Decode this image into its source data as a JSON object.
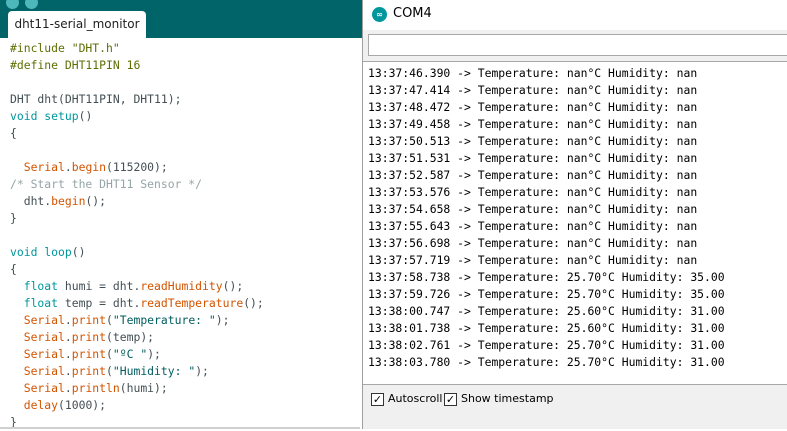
{
  "ide": {
    "tab_label": "dht11-serial_monitor",
    "code": [
      [
        {
          "t": "#include \"DHT.h\"",
          "c": "kw-pre"
        }
      ],
      [
        {
          "t": "#define DHT11PIN 16",
          "c": "kw-pre"
        }
      ],
      [],
      [
        {
          "t": "DHT dht(DHT11PIN, DHT11);",
          "c": ""
        }
      ],
      [
        {
          "t": "void",
          "c": "kw-type"
        },
        {
          "t": " ",
          "c": ""
        },
        {
          "t": "setup",
          "c": "kw-type"
        },
        {
          "t": "()",
          "c": ""
        }
      ],
      [
        {
          "t": "{",
          "c": ""
        }
      ],
      [],
      [
        {
          "t": "  ",
          "c": ""
        },
        {
          "t": "Serial",
          "c": "kw-fn"
        },
        {
          "t": ".",
          "c": ""
        },
        {
          "t": "begin",
          "c": "kw-fn"
        },
        {
          "t": "(115200);",
          "c": ""
        }
      ],
      [
        {
          "t": "/* Start the DHT11 Sensor */",
          "c": "cmt"
        }
      ],
      [
        {
          "t": "  dht.",
          "c": ""
        },
        {
          "t": "begin",
          "c": "kw-fn"
        },
        {
          "t": "();",
          "c": ""
        }
      ],
      [
        {
          "t": "}",
          "c": ""
        }
      ],
      [],
      [
        {
          "t": "void",
          "c": "kw-type"
        },
        {
          "t": " ",
          "c": ""
        },
        {
          "t": "loop",
          "c": "kw-type"
        },
        {
          "t": "()",
          "c": ""
        }
      ],
      [
        {
          "t": "{",
          "c": ""
        }
      ],
      [
        {
          "t": "  ",
          "c": ""
        },
        {
          "t": "float",
          "c": "kw-type"
        },
        {
          "t": " humi = dht.",
          "c": ""
        },
        {
          "t": "readHumidity",
          "c": "kw-fn"
        },
        {
          "t": "();",
          "c": ""
        }
      ],
      [
        {
          "t": "  ",
          "c": ""
        },
        {
          "t": "float",
          "c": "kw-type"
        },
        {
          "t": " temp = dht.",
          "c": ""
        },
        {
          "t": "readTemperature",
          "c": "kw-fn"
        },
        {
          "t": "();",
          "c": ""
        }
      ],
      [
        {
          "t": "  ",
          "c": ""
        },
        {
          "t": "Serial",
          "c": "kw-fn"
        },
        {
          "t": ".",
          "c": ""
        },
        {
          "t": "print",
          "c": "kw-fn"
        },
        {
          "t": "(",
          "c": ""
        },
        {
          "t": "\"Temperature: \"",
          "c": "str"
        },
        {
          "t": ");",
          "c": ""
        }
      ],
      [
        {
          "t": "  ",
          "c": ""
        },
        {
          "t": "Serial",
          "c": "kw-fn"
        },
        {
          "t": ".",
          "c": ""
        },
        {
          "t": "print",
          "c": "kw-fn"
        },
        {
          "t": "(temp);",
          "c": ""
        }
      ],
      [
        {
          "t": "  ",
          "c": ""
        },
        {
          "t": "Serial",
          "c": "kw-fn"
        },
        {
          "t": ".",
          "c": ""
        },
        {
          "t": "print",
          "c": "kw-fn"
        },
        {
          "t": "(",
          "c": ""
        },
        {
          "t": "\"ºC \"",
          "c": "str"
        },
        {
          "t": ");",
          "c": ""
        }
      ],
      [
        {
          "t": "  ",
          "c": ""
        },
        {
          "t": "Serial",
          "c": "kw-fn"
        },
        {
          "t": ".",
          "c": ""
        },
        {
          "t": "print",
          "c": "kw-fn"
        },
        {
          "t": "(",
          "c": ""
        },
        {
          "t": "\"Humidity: \"",
          "c": "str"
        },
        {
          "t": ");",
          "c": ""
        }
      ],
      [
        {
          "t": "  ",
          "c": ""
        },
        {
          "t": "Serial",
          "c": "kw-fn"
        },
        {
          "t": ".",
          "c": ""
        },
        {
          "t": "println",
          "c": "kw-fn"
        },
        {
          "t": "(humi);",
          "c": ""
        }
      ],
      [
        {
          "t": "  ",
          "c": ""
        },
        {
          "t": "delay",
          "c": "kw-fn"
        },
        {
          "t": "(1000);",
          "c": ""
        }
      ],
      [
        {
          "t": "}",
          "c": ""
        }
      ]
    ]
  },
  "serial": {
    "window_title": "COM4",
    "send_input_value": "",
    "lines": [
      "13:37:46.390 -> Temperature: nan°C Humidity: nan",
      "13:37:47.414 -> Temperature: nan°C Humidity: nan",
      "13:37:48.472 -> Temperature: nan°C Humidity: nan",
      "13:37:49.458 -> Temperature: nan°C Humidity: nan",
      "13:37:50.513 -> Temperature: nan°C Humidity: nan",
      "13:37:51.531 -> Temperature: nan°C Humidity: nan",
      "13:37:52.587 -> Temperature: nan°C Humidity: nan",
      "13:37:53.576 -> Temperature: nan°C Humidity: nan",
      "13:37:54.658 -> Temperature: nan°C Humidity: nan",
      "13:37:55.643 -> Temperature: nan°C Humidity: nan",
      "13:37:56.698 -> Temperature: nan°C Humidity: nan",
      "13:37:57.719 -> Temperature: nan°C Humidity: nan",
      "13:37:58.738 -> Temperature: 25.70°C Humidity: 35.00",
      "13:37:59.726 -> Temperature: 25.70°C Humidity: 35.00",
      "13:38:00.747 -> Temperature: 25.60°C Humidity: 31.00",
      "13:38:01.738 -> Temperature: 25.60°C Humidity: 31.00",
      "13:38:02.761 -> Temperature: 25.70°C Humidity: 31.00",
      "13:38:03.780 -> Temperature: 25.70°C Humidity: 31.00"
    ],
    "autoscroll": {
      "label": "Autoscroll",
      "checked": true
    },
    "show_timestamp": {
      "label": "Show timestamp",
      "checked": true
    }
  },
  "colors": {
    "ide_header": "#006468",
    "accent": "#00979c",
    "function": "#d35400",
    "preprocessor": "#5e6d03",
    "comment": "#95a5a6"
  },
  "icons": {
    "app": "arduino-icon",
    "check": "checkmark-icon"
  }
}
